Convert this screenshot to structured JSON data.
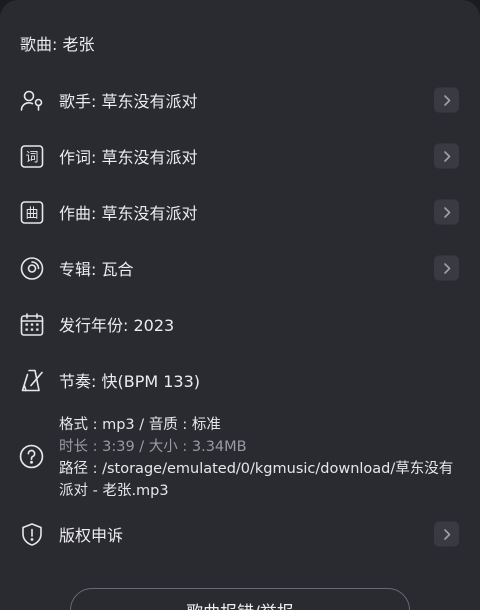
{
  "song": {
    "title": "歌曲: 老张"
  },
  "rows": [
    {
      "icon": "singer-icon",
      "label": "歌手: 草东没有派对",
      "has_arrow": true
    },
    {
      "icon": "lyrics-icon",
      "label": "作词:  草东没有派对",
      "has_arrow": true
    },
    {
      "icon": "composer-icon",
      "label": "作曲:  草东没有派对",
      "has_arrow": true
    },
    {
      "icon": "album-icon",
      "label": "专辑: 瓦合",
      "has_arrow": true
    },
    {
      "icon": "calendar-icon",
      "label": "发行年份: 2023",
      "has_arrow": false
    },
    {
      "icon": "metronome-icon",
      "label": "节奏: 快(BPM 133)",
      "has_arrow": false
    },
    {
      "icon": "copyright-icon",
      "label": "版权申诉",
      "has_arrow": true
    }
  ],
  "file_info": {
    "format_line": "格式 : mp3 / 音质 : 标准",
    "duration_line": "时长 : 3:39 / 大小 : 3.34MB",
    "path_line": "路径 : /storage/emulated/0/kgmusic/download/草东没有派对 - 老张.mp3"
  },
  "report_button": {
    "label": "歌曲报错/举报"
  }
}
